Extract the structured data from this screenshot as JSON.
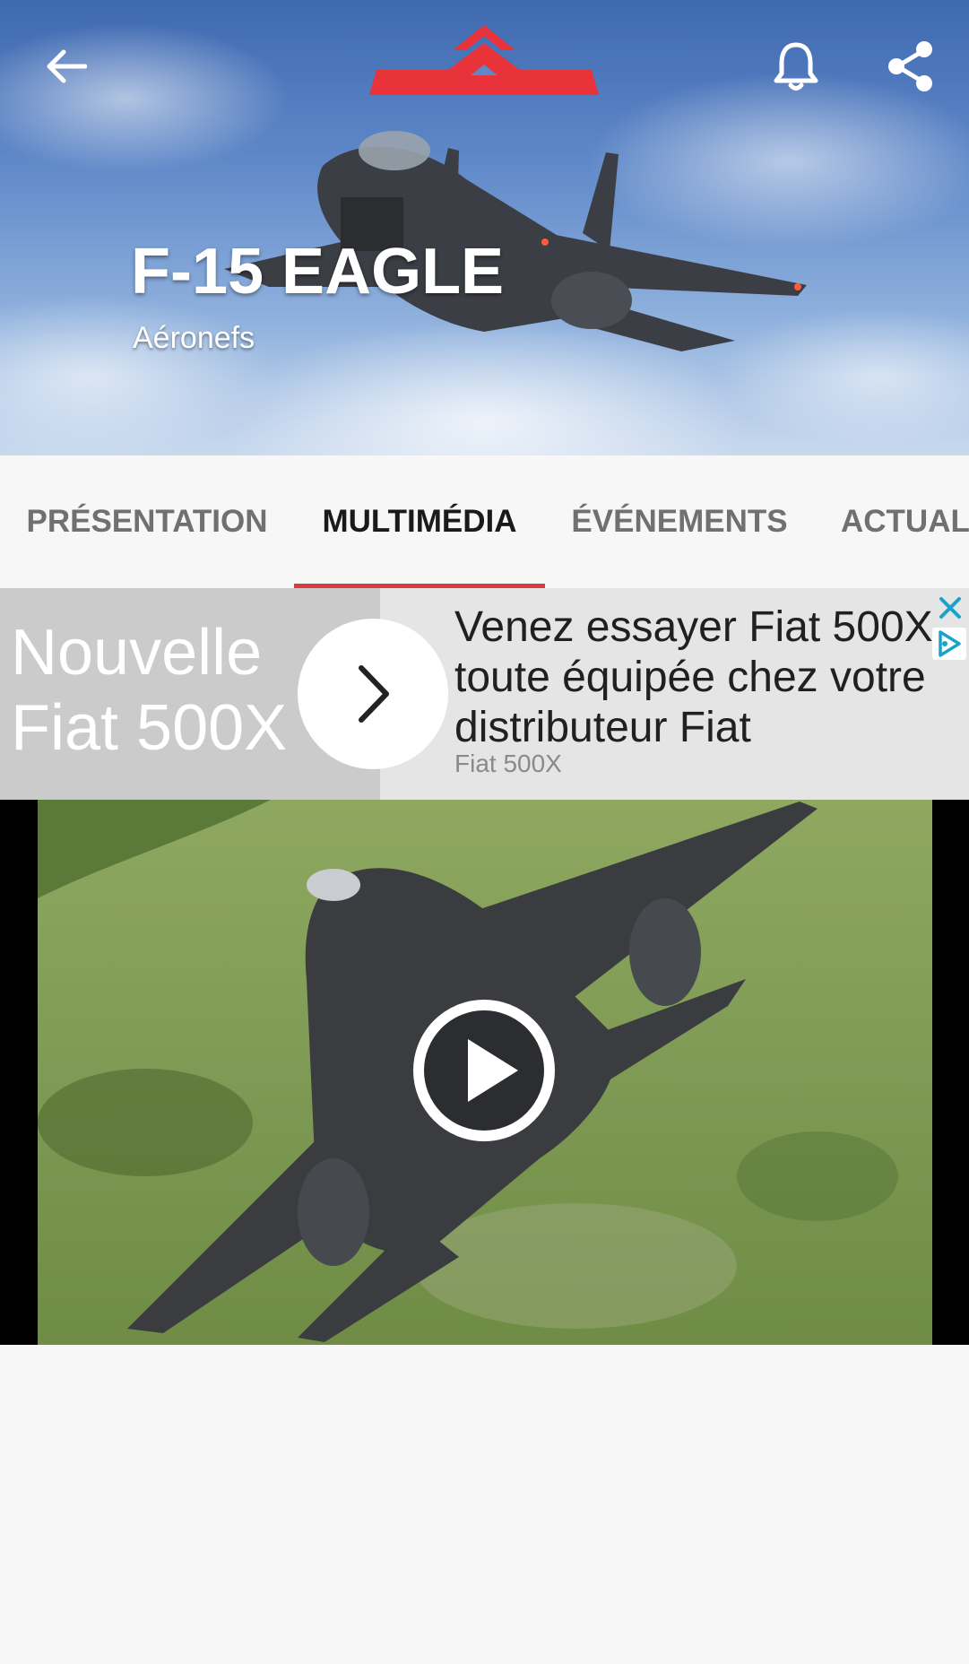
{
  "hero": {
    "title": "F-15 EAGLE",
    "subtitle": "Aéronefs",
    "back_icon": "arrow-left-icon",
    "notification_icon": "bell-icon",
    "share_icon": "share-icon",
    "logo_color": "#e8333b"
  },
  "tabs": [
    {
      "label": "PRÉSENTATION",
      "active": false
    },
    {
      "label": "MULTIMÉDIA",
      "active": true
    },
    {
      "label": "ÉVÉNEMENTS",
      "active": false
    },
    {
      "label": "ACTUAL",
      "active": false
    }
  ],
  "tab_accent_color": "#d93a3f",
  "ad": {
    "left_text": "Nouvelle Fiat 500X",
    "headline": "Venez essayer Fiat 500X toute équipée chez votre distributeur Fiat",
    "advertiser": "Fiat 500X",
    "cta_icon": "chevron-right-icon",
    "close_icon": "close-icon",
    "adchoices_icon": "adchoices-icon"
  },
  "video": {
    "play_icon": "play-icon"
  }
}
